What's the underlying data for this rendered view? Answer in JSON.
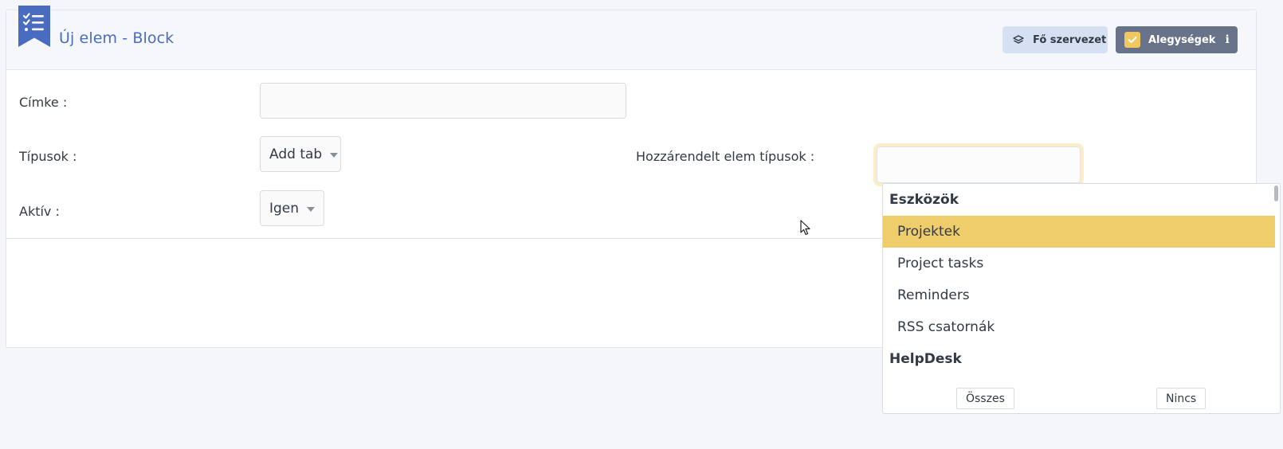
{
  "header": {
    "title": "Új elem - Block",
    "bookmark_icon": "checklist-icon",
    "org_button": {
      "label": "Fő szervezet",
      "icon": "layers-icon"
    },
    "sub_button": {
      "label": "Alegységek",
      "icon": "check-icon",
      "info_icon": "info-icon",
      "info_glyph": "ℹ"
    }
  },
  "form": {
    "label_field": {
      "label": "Címke :",
      "value": ""
    },
    "types_field": {
      "label": "Típusok :",
      "value": "Add tab"
    },
    "active_field": {
      "label": "Aktív :",
      "value": "Igen"
    },
    "assigned_field": {
      "label": "Hozzárendelt elem típusok :",
      "value": ""
    }
  },
  "dropdown": {
    "groups": [
      {
        "label": "Eszközök"
      },
      {
        "label": "HelpDesk"
      }
    ],
    "options": [
      {
        "label": "Projektek",
        "selected": true
      },
      {
        "label": "Project tasks",
        "selected": false
      },
      {
        "label": "Reminders",
        "selected": false
      },
      {
        "label": "RSS csatornák",
        "selected": false
      }
    ],
    "all_button": "Összes",
    "none_button": "Nincs"
  },
  "colors": {
    "accent": "#4a6cc0",
    "selected_option": "#f0cd6b",
    "org_button_bg": "#d5e1f3",
    "sub_button_bg": "#68738a",
    "checkbox": "#f1c75f"
  }
}
